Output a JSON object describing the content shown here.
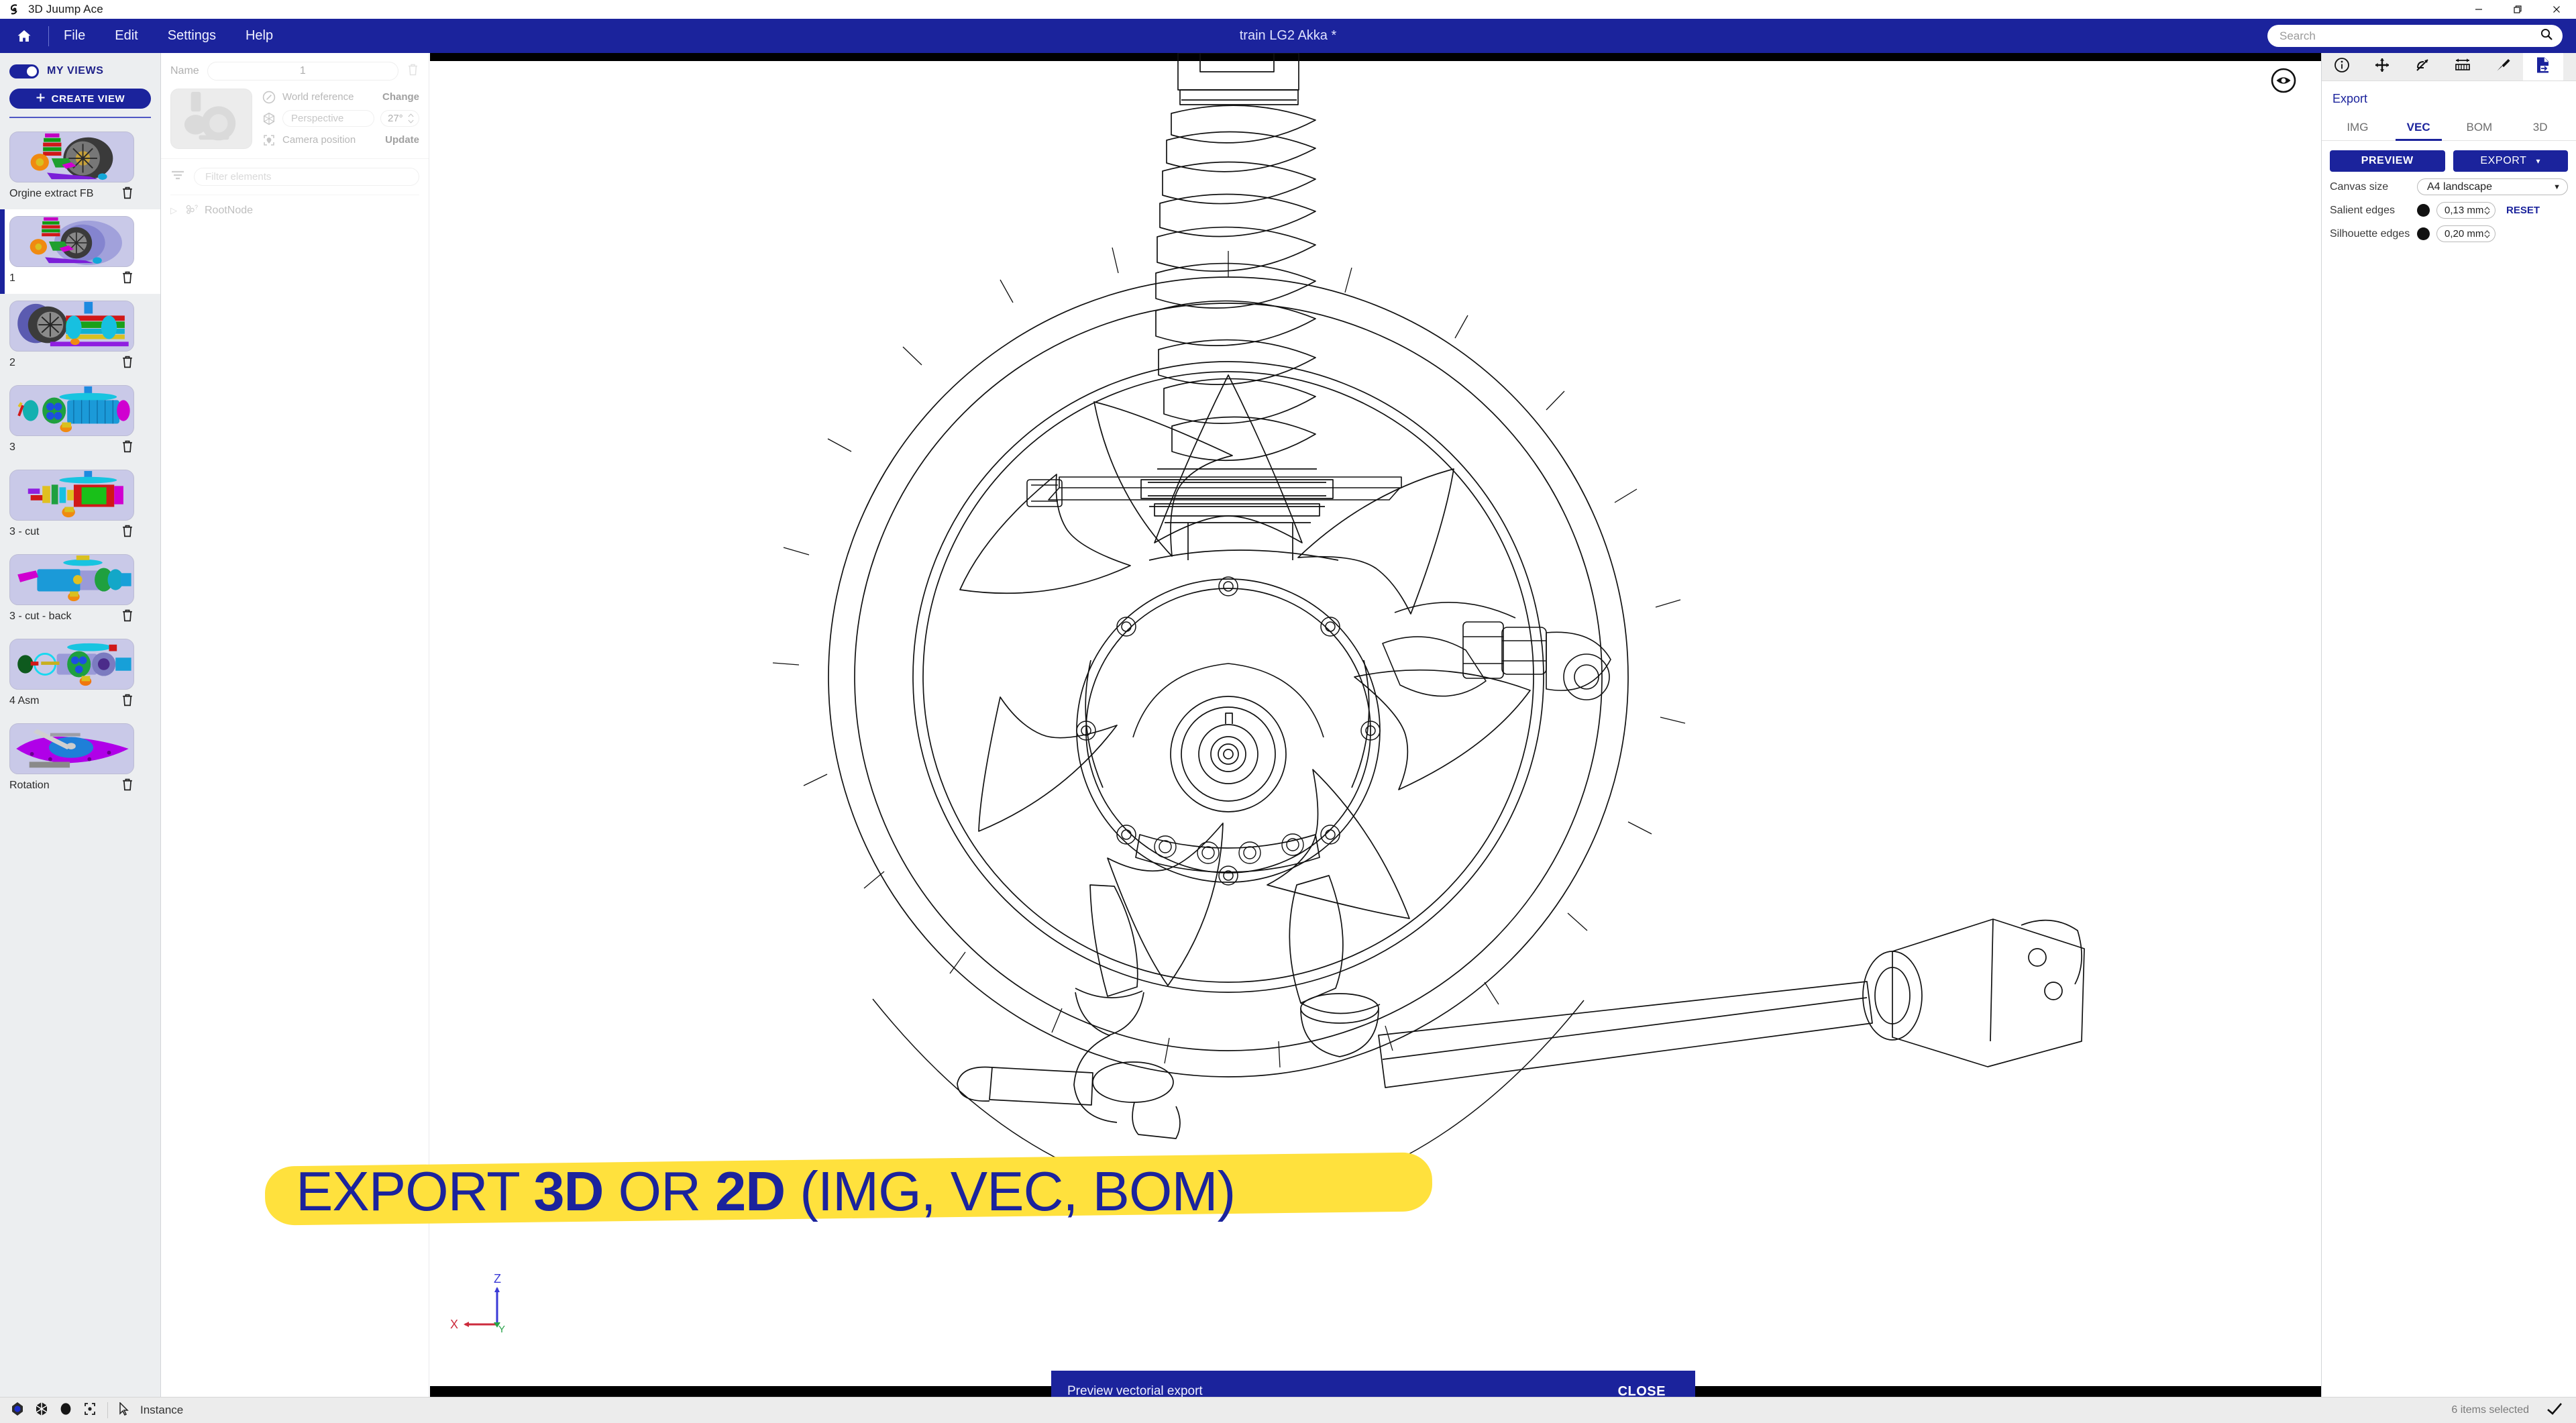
{
  "window": {
    "app_title": "3D Juump Ace",
    "logo_icon": "spiral-logo-icon",
    "minimize_icon": "minimize-icon",
    "maximize_icon": "maximize-icon",
    "close_icon": "close-icon"
  },
  "menubar": {
    "home_icon": "home-icon",
    "items": [
      {
        "label": "File"
      },
      {
        "label": "Edit"
      },
      {
        "label": "Settings"
      },
      {
        "label": "Help"
      }
    ],
    "document_title": "train LG2 Akka *",
    "search": {
      "placeholder": "Search",
      "value": "",
      "icon": "search-icon"
    }
  },
  "views_panel": {
    "toggle_label": "MY VIEWS",
    "toggle_on": true,
    "create_button": "CREATE VIEW",
    "create_icon": "plus-icon",
    "delete_icon": "trash-icon",
    "items": [
      {
        "name": "Orgine extract FB",
        "selected": false
      },
      {
        "name": "1",
        "selected": true
      },
      {
        "name": "2",
        "selected": false
      },
      {
        "name": "3",
        "selected": false
      },
      {
        "name": "3 - cut",
        "selected": false
      },
      {
        "name": "3 - cut - back",
        "selected": false
      },
      {
        "name": "4 Asm",
        "selected": false
      },
      {
        "name": "Rotation",
        "selected": false
      }
    ]
  },
  "props_panel": {
    "name_label": "Name",
    "name_value": "1",
    "delete_icon": "trash-icon",
    "world_reference": {
      "label": "World reference",
      "action": "Change",
      "icon": "compass-icon"
    },
    "projection": {
      "value": "Perspective",
      "angle": "27°",
      "icon": "perspective-cube-icon"
    },
    "camera_position": {
      "label": "Camera position",
      "action": "Update",
      "icon": "camera-target-icon"
    },
    "filter": {
      "placeholder": "Filter elements",
      "value": "",
      "icon": "filter-icon"
    },
    "tree": [
      {
        "label": "RootNode",
        "icon": "assembly-icon",
        "expanded": false
      }
    ]
  },
  "canvas": {
    "eye_icon": "eye-icon",
    "axis": {
      "x": "X",
      "y": "Y",
      "z": "Z",
      "x_color": "#cc2b3c",
      "y_color": "#2aa34a",
      "z_color": "#3a3ad6"
    },
    "overlay": {
      "part1": "EXPORT ",
      "bold1": "3D",
      "part2": " OR ",
      "bold2": "2D",
      "part3": " (IMG, VEC, BOM)",
      "highlight_color": "#ffe13d",
      "text_color": "#1b239c"
    },
    "toast": {
      "message": "Preview vectorial export",
      "close_label": "CLOSE"
    }
  },
  "right_panel": {
    "tool_tabs": [
      {
        "icon": "info-icon",
        "active": false
      },
      {
        "icon": "move-icon",
        "active": false
      },
      {
        "icon": "cut-section-icon",
        "active": false
      },
      {
        "icon": "measure-ruler-icon",
        "active": false
      },
      {
        "icon": "paint-brush-icon",
        "active": false
      },
      {
        "icon": "export-file-icon",
        "active": true
      }
    ],
    "heading": "Export",
    "format_tabs": [
      {
        "label": "IMG",
        "active": false
      },
      {
        "label": "VEC",
        "active": true
      },
      {
        "label": "BOM",
        "active": false
      },
      {
        "label": "3D",
        "active": false
      }
    ],
    "preview_button": "PREVIEW",
    "export_button": "EXPORT",
    "export_caret": "▾",
    "canvas_size": {
      "label": "Canvas size",
      "value": "A4 landscape"
    },
    "salient_edges": {
      "label": "Salient edges",
      "value": "0,13 mm",
      "color": "#111111"
    },
    "silhouette_edges": {
      "label": "Silhouette edges",
      "value": "0,20 mm",
      "color": "#111111"
    },
    "reset_label": "RESET"
  },
  "statusbar": {
    "icons": [
      "gem-orient-icon",
      "cube-orient-icon",
      "sphere-shade-icon",
      "fit-target-icon"
    ],
    "cursor_icon": "pointer-icon",
    "mode_label": "Instance",
    "selection_text": "6 items selected",
    "confirm_icon": "check-icon"
  }
}
